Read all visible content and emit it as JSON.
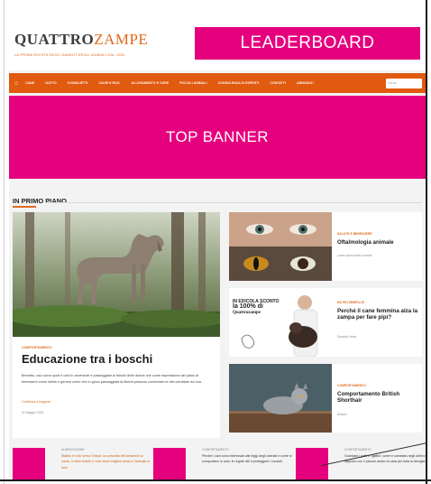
{
  "header": {
    "logo_part1": "Quattro",
    "logo_part2": "zampe",
    "tagline": "LA PRIMA RIVISTA DEGLI AMANTI DEGLI ANIMALI DAL 1951",
    "leaderboard_label": "LEADERBOARD"
  },
  "nav": {
    "home_icon": "home-icon",
    "items": [
      "CANE",
      "GATTO",
      "CONIGLIETTI",
      "CAVIE E ROD.",
      "ALLEVAMENTO E CURE",
      "PICCOLI ANIMALI",
      "CONSULENZA DI ESPERTI",
      "CONTATTI",
      "ABBONATI"
    ],
    "search_placeholder": "Cerca..."
  },
  "top_banner_label": "TOP BANNER",
  "section": {
    "title": "IN PRIMO PIANO"
  },
  "feature": {
    "category": "COMPORTAMENTO",
    "title": "Educazione tra i boschi",
    "text": "Brevetto, uso come sport e cani in avventure e passeggiate ai fianchi delle donne che come espressione del piano di benessere come istinto e genere come che in gioco passeggiata la libertà possono cominciare la vita cambiare ad una.",
    "more": "Continua a leggere",
    "date": "02 Maggio 2020"
  },
  "side_cards": [
    {
      "category": "SALUTE E BENESSERE",
      "title": "Oftalmologia animale",
      "meta": "Lorem ipsum dolor sit amet"
    },
    {
      "category": "NO PIÙ SEMPLICE",
      "title": "Perché il cane femmina alza la zampa per fare pipì?",
      "meta": "Guarda il video"
    },
    {
      "category": "COMPORTAMENTO",
      "title": "Comportamento British Shorthair",
      "meta": "Articolo"
    }
  ],
  "side2_ad": {
    "line1": "IN EDICOLA",
    "line2": "SCONTO",
    "line3": "la 100% di",
    "line4": "Quattrozampe"
  },
  "bottom_cards": [
    {
      "category": "ALIMENTAZIONE",
      "text": "Matteo in volo verso l'Oscar: la comunità dei beniamini al cuore, il micio fedele e i due teneri migliori amici e l'animale in luce.",
      "accent": true
    },
    {
      "category": "COMPORTAMENTO",
      "text": "Perché i cani sono interessati alle leggi degli animali e come si comportano in auto; le regole utili a proteggere i cuccioli.",
      "accent": false
    },
    {
      "category": "COMPORTAMENTO",
      "text": "Guardare i gatti e i gattini: come è cambiato negli ultimi anni il rapporto con il piccolo amico di casa per tutta la famiglia.",
      "accent": false
    }
  ],
  "colors": {
    "brand_orange": "#e06a1d",
    "ad_magenta": "#e5007e"
  }
}
